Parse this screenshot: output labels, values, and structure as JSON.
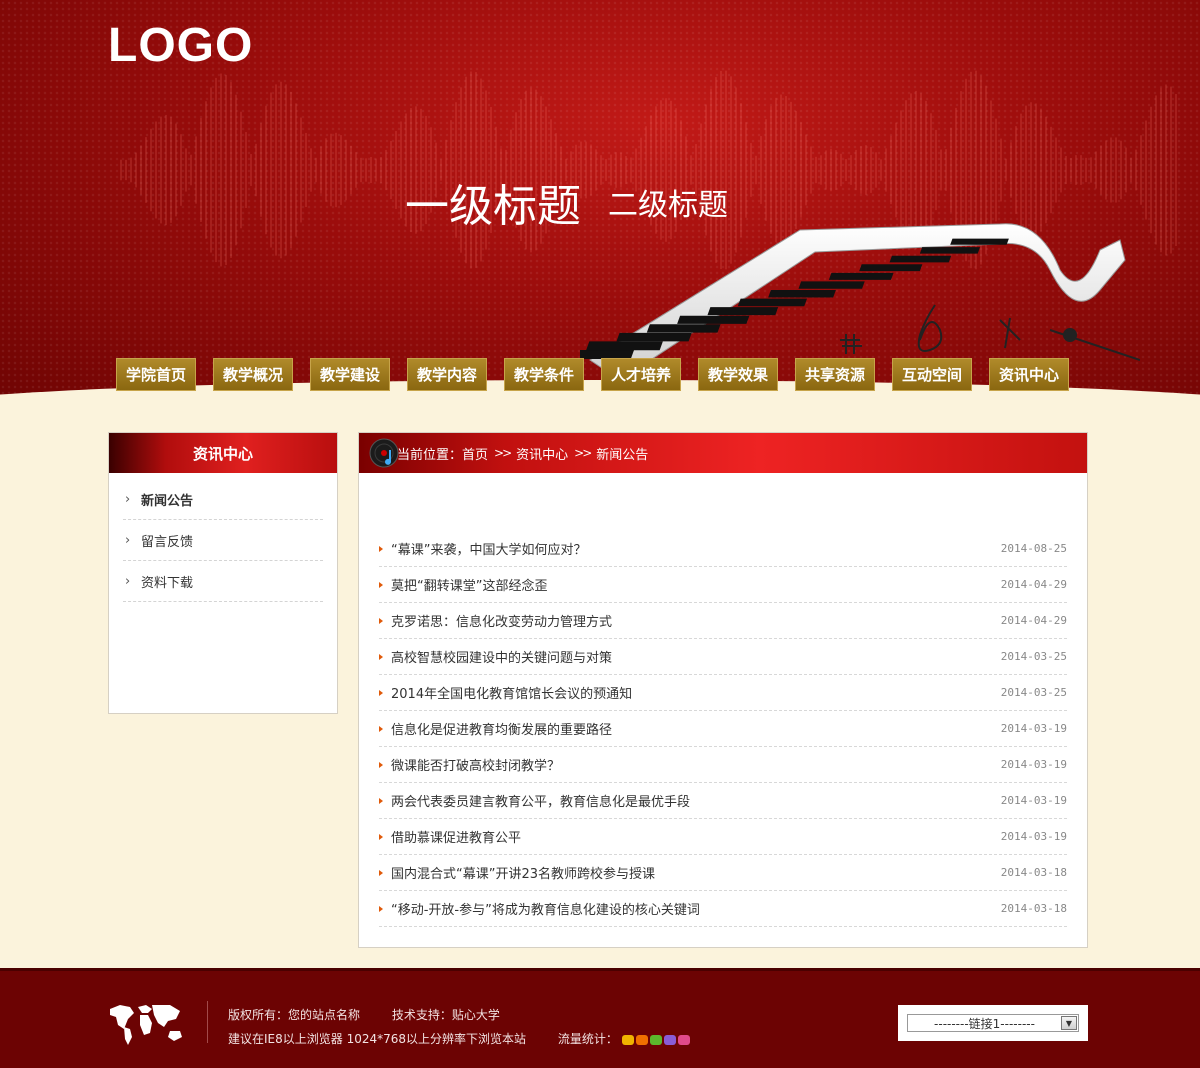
{
  "header": {
    "logo": "LOGO",
    "title_main": "一级标题",
    "title_sub": "二级标题"
  },
  "nav": [
    "学院首页",
    "教学概况",
    "教学建设",
    "教学内容",
    "教学条件",
    "人才培养",
    "教学效果",
    "共享资源",
    "互动空间",
    "资讯中心"
  ],
  "sidebar": {
    "title": "资讯中心",
    "items": [
      "新闻公告",
      "留言反馈",
      "资料下载"
    ],
    "active_index": 0
  },
  "breadcrumb": {
    "prefix": "当前位置：",
    "items": [
      "首页",
      "资讯中心",
      "新闻公告"
    ]
  },
  "news": [
    {
      "title": "“幕课”来袭，中国大学如何应对？",
      "date": "2014-08-25"
    },
    {
      "title": "莫把“翻转课堂”这部经念歪",
      "date": "2014-04-29"
    },
    {
      "title": "克罗诺思：信息化改变劳动力管理方式",
      "date": "2014-04-29"
    },
    {
      "title": "高校智慧校园建设中的关键问题与对策",
      "date": "2014-03-25"
    },
    {
      "title": "2014年全国电化教育馆馆长会议的预通知",
      "date": "2014-03-25"
    },
    {
      "title": "信息化是促进教育均衡发展的重要路径",
      "date": "2014-03-19"
    },
    {
      "title": "微课能否打破高校封闭教学？",
      "date": "2014-03-19"
    },
    {
      "title": "两会代表委员建言教育公平，教育信息化是最优手段",
      "date": "2014-03-19"
    },
    {
      "title": "借助慕课促进教育公平",
      "date": "2014-03-19"
    },
    {
      "title": "国内混合式“幕课”开讲23名教师跨校参与授课",
      "date": "2014-03-18"
    },
    {
      "title": "“移动-开放-参与”将成为教育信息化建设的核心关键词",
      "date": "2014-03-18"
    }
  ],
  "footer": {
    "copyright": "版权所有：您的站点名称",
    "tech": "技术支持：贴心大学",
    "browser_note": "建议在IE8以上浏览器 1024*768以上分辨率下浏览本站",
    "traffic_label": "流量统计：",
    "link_select": "--------链接1--------"
  },
  "colors": {
    "header_red": "#9a0c0b",
    "nav_gold": "#8a6710",
    "footer_red": "#6c0303",
    "page_bg": "#fbf3dc",
    "bullet_orange": "#e05a0a"
  }
}
